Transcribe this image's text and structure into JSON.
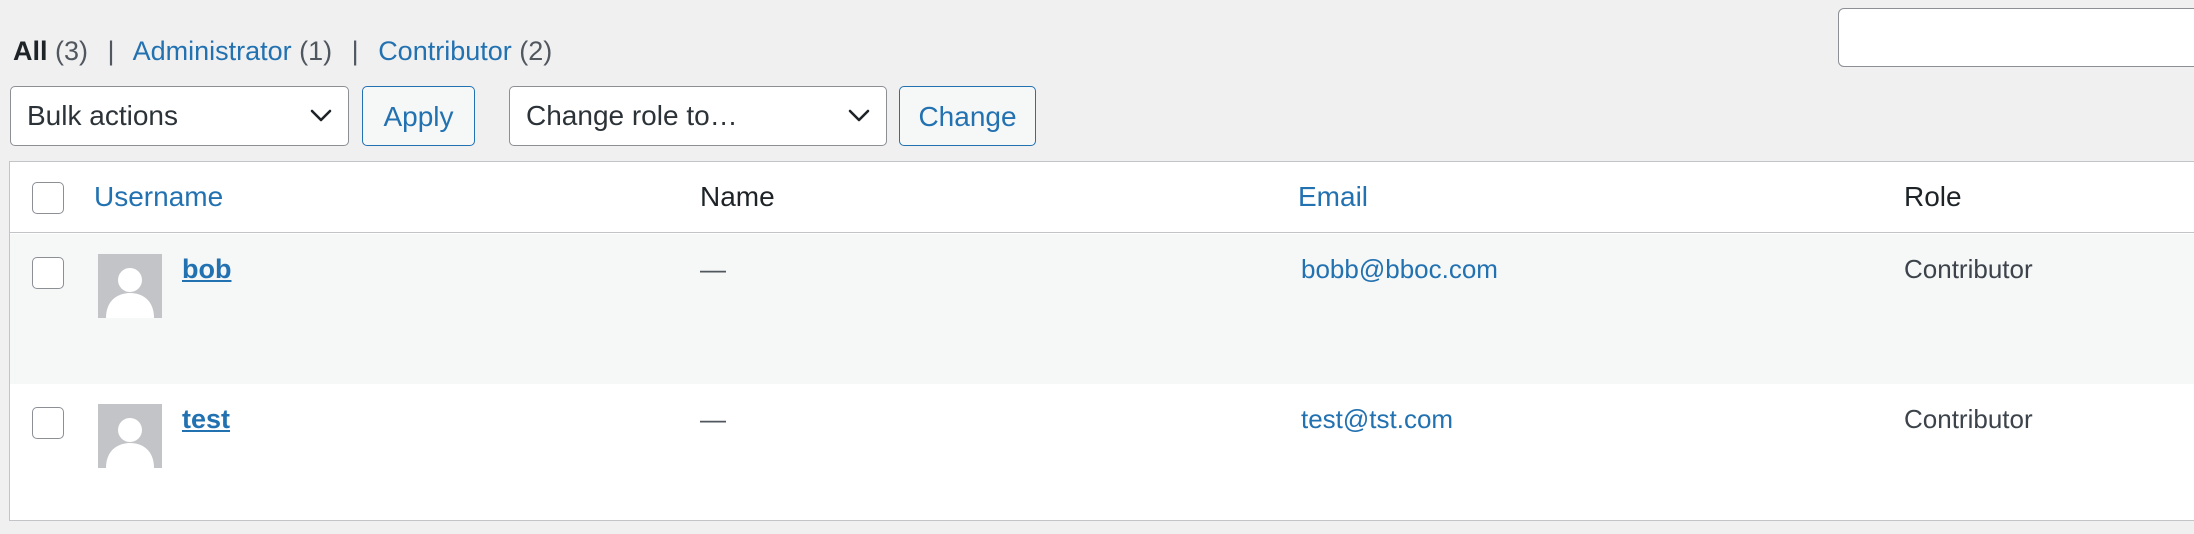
{
  "views": {
    "all": {
      "label": "All",
      "count": "(3)"
    },
    "administrator": {
      "label": "Administrator",
      "count": "(1)"
    },
    "contributor": {
      "label": "Contributor",
      "count": "(2)"
    },
    "separator": "|"
  },
  "search": {
    "value": "",
    "placeholder": ""
  },
  "bulk_actions": {
    "selected": "Bulk actions",
    "apply_label": "Apply"
  },
  "change_role": {
    "selected": "Change role to…",
    "change_label": "Change"
  },
  "table": {
    "headers": {
      "username": "Username",
      "name": "Name",
      "email": "Email",
      "role": "Role"
    },
    "rows": [
      {
        "username": "bob",
        "name": "—",
        "email": "bobb@bboc.com",
        "role": "Contributor"
      },
      {
        "username": "test",
        "name": "—",
        "email": "test@tst.com",
        "role": "Contributor"
      }
    ]
  },
  "colors": {
    "link": "#2271b1",
    "text": "#1d2327",
    "background": "#f0f0f1",
    "alt_row": "#f6f7f7",
    "border": "#c3c4c7"
  },
  "icons": {
    "select_arrow": "chevron-down-icon",
    "avatar": "default-avatar-icon"
  }
}
